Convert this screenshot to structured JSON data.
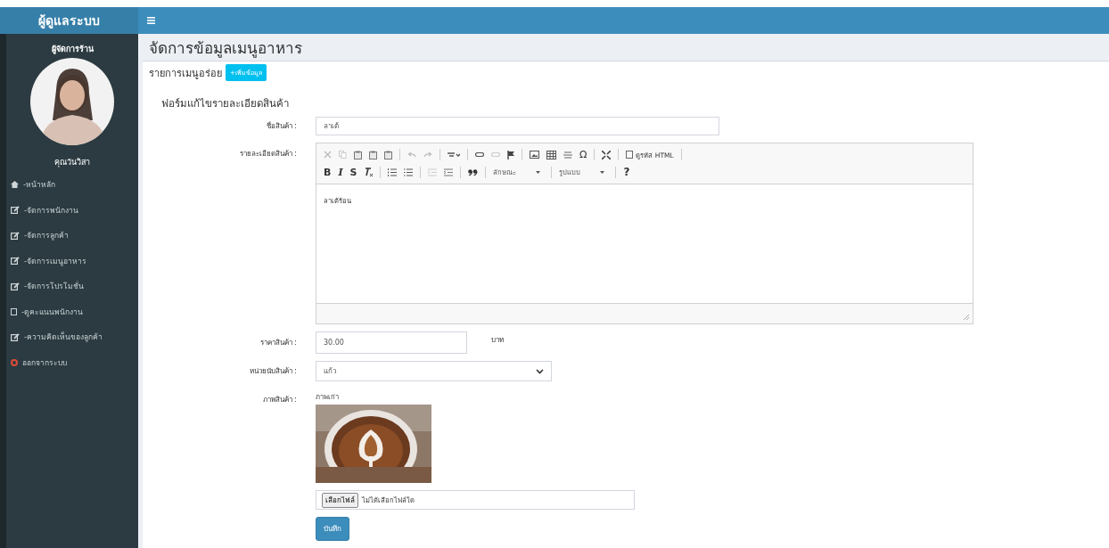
{
  "sidebar": {
    "brand": "ผู้ดูแลระบบ",
    "role": "ผู้จัดการร้าน",
    "user_name": "คุณวันวิสา",
    "items": [
      {
        "label": "-หน้าหลัก",
        "kind": "home"
      },
      {
        "label": "-จัดการพนักงาน",
        "kind": "edit"
      },
      {
        "label": "-จัดการลูกค้า",
        "kind": "edit"
      },
      {
        "label": "-จัดการเมนูอาหาร",
        "kind": "edit"
      },
      {
        "label": "-จัดการโปรโมชั่น",
        "kind": "edit"
      },
      {
        "label": "-ดูคะแนนพนักงาน",
        "kind": "square"
      },
      {
        "label": "-ความคิดเห็นของลูกค้า",
        "kind": "edit"
      },
      {
        "label": "ออกจากระบบ",
        "kind": "logout"
      }
    ]
  },
  "content": {
    "title": "จัดการข้อมูลเมนูอาหาร",
    "list_label": "รายการเมนูอร่อย",
    "add_button": "+เพิ่มข้อมูล"
  },
  "form": {
    "title": "ฟอร์มแก้ไขรายละเอียดสินค้า",
    "name": {
      "label": "ชื่อสินค้า :",
      "value": "ลาเต้"
    },
    "detail": {
      "label": "รายละเอียดสินค้า :",
      "value": "ลาเต้ร้อน",
      "toolbar": {
        "source": "ดูรหัส HTML",
        "special_char": "Ω",
        "bold": "B",
        "italic": "I",
        "strike": "S",
        "style_dropdown": "ลักษณะ",
        "format_dropdown": "รูปแบบ",
        "help": "?"
      }
    },
    "price": {
      "label": "ราคาสินค้า :",
      "value": "30.00",
      "unit": "บาท"
    },
    "unit": {
      "label": "หน่วยนับสินค้า :",
      "value": "แก้ว"
    },
    "image": {
      "label": "ภาพสินค้า :",
      "caption": "ภาพเก่า",
      "file_button": "เลือกไฟล์",
      "file_status": "ไม่ได้เลือกไฟล์ใด"
    },
    "save_button": "บันทึก"
  }
}
